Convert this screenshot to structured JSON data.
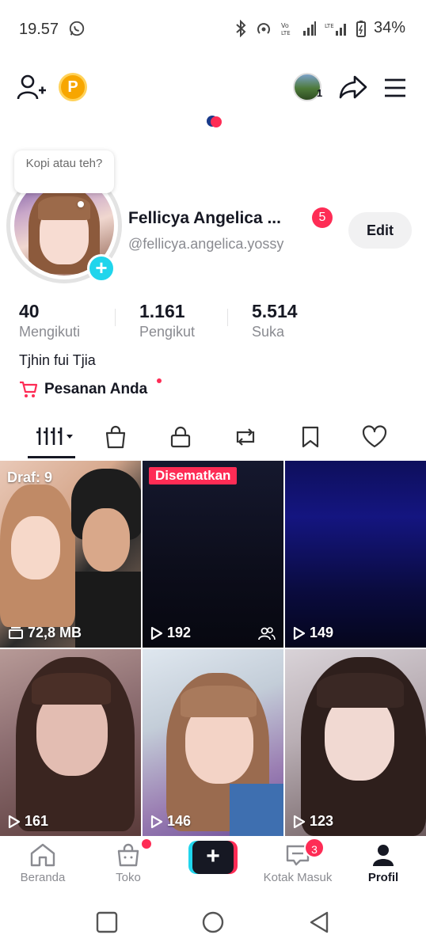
{
  "status_bar": {
    "time": "19.57",
    "battery": "34%"
  },
  "profile": {
    "bubble_text": "Kopi atau teh?",
    "name": "Fellicya Angelica ...",
    "name_badge": "5",
    "username": "@fellicya.angelica.yossy",
    "edit_label": "Edit",
    "header_avatar_count": "1",
    "coin_letter": "P"
  },
  "stats": [
    {
      "value": "40",
      "label": "Mengikuti"
    },
    {
      "value": "1.161",
      "label": "Pengikut"
    },
    {
      "value": "5.514",
      "label": "Suka"
    }
  ],
  "bio": "Tjhin fui Tjia",
  "orders_label": "Pesanan Anda",
  "tabs": [
    "videos-tab",
    "shop-tab",
    "private-tab",
    "repost-tab",
    "favorites-tab",
    "liked-tab"
  ],
  "grid": {
    "draft_label": "Draf: 9",
    "draft_size": "72,8 MB",
    "pinned_label": "Disematkan",
    "views": [
      "192",
      "149",
      "161",
      "146",
      "123"
    ]
  },
  "bottom_nav": {
    "home": "Beranda",
    "shop": "Toko",
    "inbox": "Kotak Masuk",
    "inbox_badge": "3",
    "profile": "Profil"
  },
  "colors": {
    "accent": "#fe2c55",
    "cyan": "#20d5ec",
    "text": "#161823",
    "muted": "#8a8b91"
  }
}
